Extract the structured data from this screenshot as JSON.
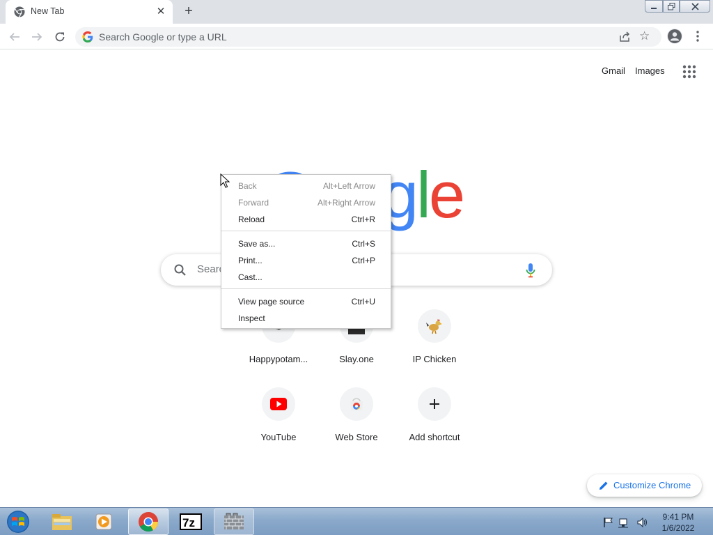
{
  "browser": {
    "tab_title": "New Tab",
    "omnibox_placeholder": "Search Google or type a URL"
  },
  "page": {
    "top_links": [
      "Gmail",
      "Images"
    ],
    "logo_letters": [
      "G",
      "o",
      "o",
      "g",
      "l",
      "e"
    ],
    "logo_colors": [
      "#4285f4",
      "#ea4335",
      "#fbbc05",
      "#4285f4",
      "#34a853",
      "#ea4335"
    ],
    "search_placeholder": "Search Google or type a URL",
    "shortcuts": [
      {
        "label": "Happypotam..."
      },
      {
        "label": "Slay.one"
      },
      {
        "label": "IP Chicken"
      },
      {
        "label": "YouTube"
      },
      {
        "label": "Web Store"
      },
      {
        "label": "Add shortcut"
      }
    ],
    "customize_label": "Customize Chrome"
  },
  "context_menu": {
    "items": [
      {
        "label": "Back",
        "shortcut": "Alt+Left Arrow",
        "disabled": true
      },
      {
        "label": "Forward",
        "shortcut": "Alt+Right Arrow",
        "disabled": true
      },
      {
        "label": "Reload",
        "shortcut": "Ctrl+R",
        "disabled": false
      },
      {
        "label": "Save as...",
        "shortcut": "Ctrl+S",
        "disabled": false
      },
      {
        "label": "Print...",
        "shortcut": "Ctrl+P",
        "disabled": false
      },
      {
        "label": "Cast...",
        "shortcut": "",
        "disabled": false
      },
      {
        "label": "View page source",
        "shortcut": "Ctrl+U",
        "disabled": false
      },
      {
        "label": "Inspect",
        "shortcut": "",
        "disabled": false
      }
    ]
  },
  "taskbar": {
    "clock_time": "9:41 PM",
    "clock_date": "1/6/2022",
    "apps": [
      "start-orb",
      "file-explorer",
      "media-player",
      "chrome",
      "7-zip",
      "firewall-app"
    ]
  },
  "colors": {
    "accent_blue": "#1a73e8",
    "tab_strip": "#dee1e6"
  }
}
